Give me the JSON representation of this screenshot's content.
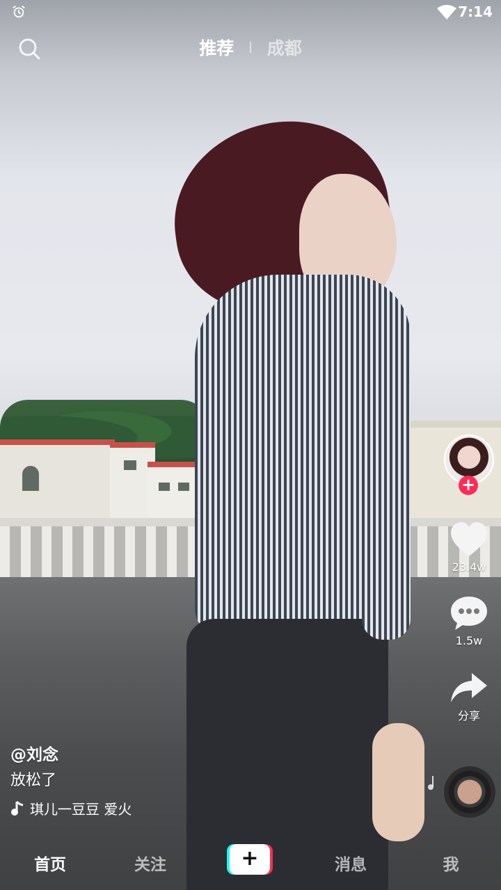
{
  "status_bar": {
    "time": "7:14",
    "icons": [
      "alarm-icon",
      "wifi-icon"
    ]
  },
  "top_nav": {
    "search_icon": "search-icon",
    "tabs": [
      {
        "label": "推荐",
        "active": true
      },
      {
        "label": "成都",
        "active": false
      }
    ]
  },
  "sidebar": {
    "avatar_icon": "avatar",
    "follow_symbol": "+",
    "like": {
      "icon": "heart-icon",
      "count": "23.4w"
    },
    "comment": {
      "icon": "comment-icon",
      "count": "1.5w"
    },
    "share": {
      "icon": "share-icon",
      "label": "分享"
    }
  },
  "video_info": {
    "author": "@刘念",
    "caption": "放松了",
    "music": "琪儿一豆豆   爱火",
    "music_icon": "music-note-icon"
  },
  "bottom_nav": {
    "items": [
      {
        "label": "首页",
        "active": true
      },
      {
        "label": "关注",
        "active": false
      },
      {
        "label": "+",
        "type": "create"
      },
      {
        "label": "消息",
        "active": false
      },
      {
        "label": "我",
        "active": false
      }
    ]
  },
  "colors": {
    "accent_red": "#fe2c55",
    "accent_cyan": "#25f4ee",
    "text": "#ffffff"
  }
}
